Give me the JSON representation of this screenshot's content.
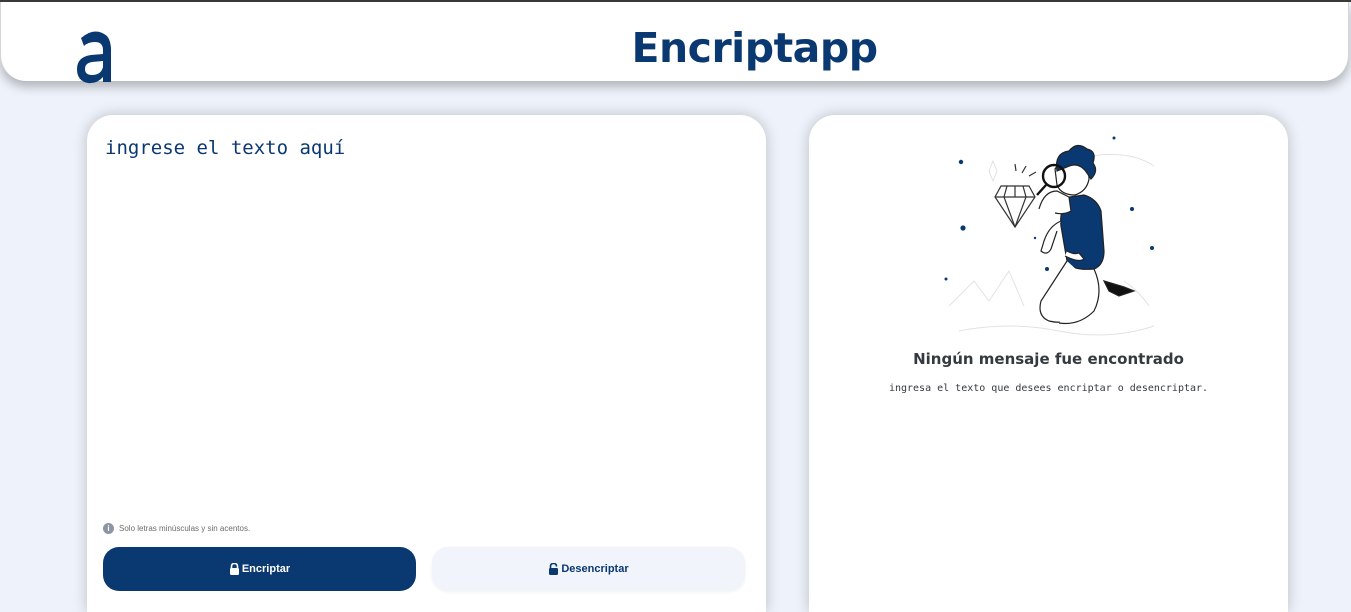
{
  "header": {
    "title": "Encriptapp",
    "logo_icon": "alura-a-logo-icon"
  },
  "colors": {
    "primary": "#0a3871",
    "background": "#eef2fa",
    "secondary_button": "#f1f4fa",
    "text_dark": "#343a40"
  },
  "input_panel": {
    "placeholder": "ingrese el texto aquí",
    "value": "",
    "hint_icon": "info-icon",
    "hint": "Solo letras minúsculas y sin acentos.",
    "encrypt_icon": "lock-icon",
    "encrypt_label": "Encriptar",
    "decrypt_icon": "unlock-icon",
    "decrypt_label": "Desencriptar"
  },
  "output_panel": {
    "illustration": "person-with-magnifying-glass-illustration",
    "title": "Ningún mensaje fue encontrado",
    "subtitle": "ingresa el texto que desees encriptar o desencriptar."
  }
}
